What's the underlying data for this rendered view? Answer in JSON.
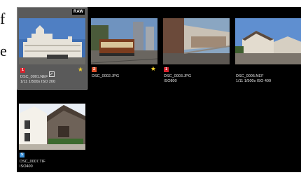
{
  "background_text": {
    "line1": "f",
    "line2": "e",
    "line3": ""
  },
  "thumbnails": [
    {
      "filename": "DSC_0001.NEF",
      "info": "1/11 1/500s ISO 200",
      "format_tag": "RAW",
      "label": "1",
      "label_color": "#d9232e",
      "starred": true,
      "selected": true,
      "has_edit_icon": true
    },
    {
      "filename": "DSC_0002.JPG",
      "info": "",
      "label": "2",
      "label_color": "#e0512a",
      "starred": true
    },
    {
      "filename": "DSC_0003.JPG",
      "info": "ISO800",
      "label": "1",
      "label_color": "#d9232e",
      "starred": false
    },
    {
      "filename": "DSC_0005.NEF",
      "info": "1/11 1/500s ISO 400",
      "label": "",
      "starred": false
    },
    {
      "filename": "DSC_0007.TIF",
      "info": "ISO400",
      "label": "5",
      "label_color": "#3a8fd6",
      "starred": false
    }
  ],
  "colors": {
    "star": "#f3d22b",
    "selection_bg": "#5a5a5a"
  }
}
